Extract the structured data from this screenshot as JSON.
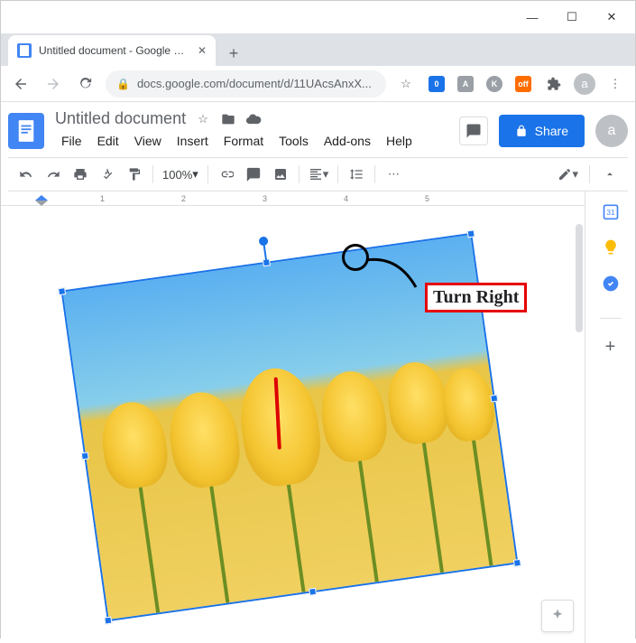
{
  "window": {
    "min": "—",
    "max": "☐",
    "close": "✕"
  },
  "tab": {
    "title": "Untitled document - Google Doc"
  },
  "address": {
    "url": "docs.google.com/document/d/11UAcsAnxX..."
  },
  "doc": {
    "title": "Untitled document",
    "menus": [
      "File",
      "Edit",
      "View",
      "Insert",
      "Format",
      "Tools",
      "Add-ons",
      "Help"
    ],
    "share": "Share",
    "zoom": "100%"
  },
  "ruler": {
    "ticks": [
      "1",
      "2",
      "3",
      "4",
      "5"
    ]
  },
  "annotation": {
    "label": "Turn Right"
  },
  "avatar": {
    "letter": "a"
  }
}
